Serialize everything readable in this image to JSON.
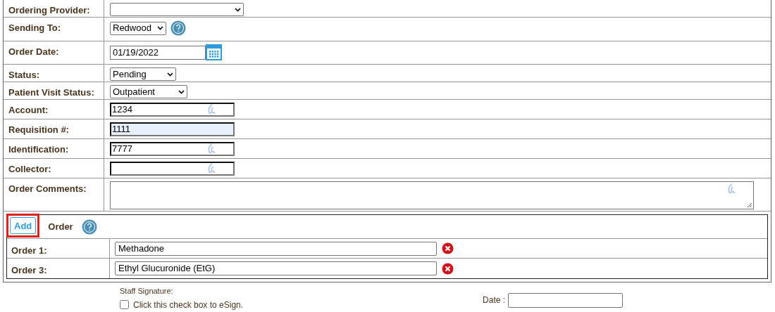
{
  "fields": [
    {
      "label": "Ordering Provider:",
      "kind": "select"
    },
    {
      "label": "Sending To:",
      "kind": "select_help",
      "value": "Redwood"
    },
    {
      "label": "Order Date:",
      "kind": "date",
      "value": "01/19/2022"
    },
    {
      "label": "Status:",
      "kind": "select",
      "value": "Pending"
    },
    {
      "label": "Patient Visit Status:",
      "kind": "select",
      "value": "Outpatient"
    },
    {
      "label": "Account:",
      "kind": "text",
      "value": "1234",
      "focused": false
    },
    {
      "label": "Requisition #:",
      "kind": "text",
      "value": "1111",
      "focused": true
    },
    {
      "label": "Identification:",
      "kind": "text",
      "value": "7777",
      "focused": false
    },
    {
      "label": "Collector:",
      "kind": "text",
      "focused": false
    },
    {
      "label": "Order Comments:",
      "kind": "textarea"
    }
  ],
  "orders": {
    "add_button": "Add",
    "label": "Order",
    "items": [
      {
        "label": "Order 1:",
        "value": "Methadone"
      },
      {
        "label": "Order 3:",
        "value": "Ethyl Glucuronide (EtG)"
      }
    ]
  },
  "signature": {
    "label": "Staff Signature:",
    "checkbox_label": "Click this check box to eSign.",
    "checked": false,
    "date_label": "Date :"
  }
}
